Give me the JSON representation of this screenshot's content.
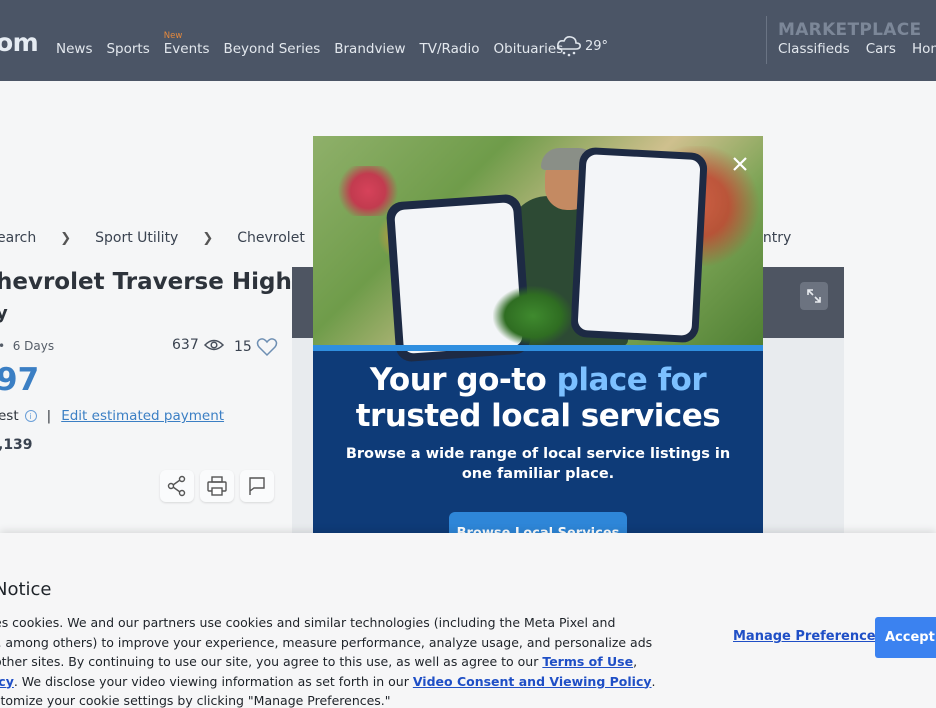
{
  "header": {
    "logo": "om",
    "nav": [
      {
        "label": "News",
        "badge": ""
      },
      {
        "label": "Sports",
        "badge": ""
      },
      {
        "label": "Events",
        "badge": "New"
      },
      {
        "label": "Beyond Series",
        "badge": ""
      },
      {
        "label": "Brandview",
        "badge": ""
      },
      {
        "label": "TV/Radio",
        "badge": ""
      },
      {
        "label": "Obituaries",
        "badge": ""
      }
    ],
    "weather_temp": "29°",
    "weather_icon": "snow-cloud-icon",
    "marketplace_title": "MARKETPLACE",
    "marketplace_links": [
      "Classifieds",
      "Cars",
      "Home"
    ]
  },
  "breadcrumb": {
    "items": [
      "earch",
      "Sport Utility",
      "Chevrolet"
    ],
    "tail": "untry"
  },
  "listing": {
    "title_line1": "hevrolet Traverse High",
    "title_line2": "y",
    "posted": "6 Days",
    "views": "637",
    "likes": "15",
    "price": "97",
    "est_label": "est",
    "edit_payment": "Edit estimated payment",
    "subprice": ",139"
  },
  "ad": {
    "headline_part1": "Your go-to ",
    "headline_part2": "place for",
    "headline_part3": "trusted local services",
    "subtext": "Browse a wide range of local service listings in one familiar place.",
    "cta": "Browse Local Services",
    "colors": {
      "background": "#0e3b78",
      "accent": "#7cc0ff",
      "button": "#2e86d8"
    }
  },
  "cookie": {
    "title": "Notice",
    "line1": "es cookies. We and our partners use cookies and similar technologies (including the Meta Pixel and",
    "line2": "l, among others) to improve your experience, measure performance, analyze usage, and personalize ads",
    "line3_pre": "other sites. By continuing to use our site, you agree to this use, as well as agree to our ",
    "terms_link": "Terms of Use",
    "line3_post": ",",
    "line4_link": "icy",
    "line4_mid": ". We disclose your video viewing information as set forth in our ",
    "video_link": "Video Consent and Viewing Policy",
    "line4_post": ".",
    "line5": "stomize your cookie settings by clicking \"Manage Preferences.\"",
    "manage_label": "Manage Preferences",
    "accept_label": "Accept all"
  }
}
